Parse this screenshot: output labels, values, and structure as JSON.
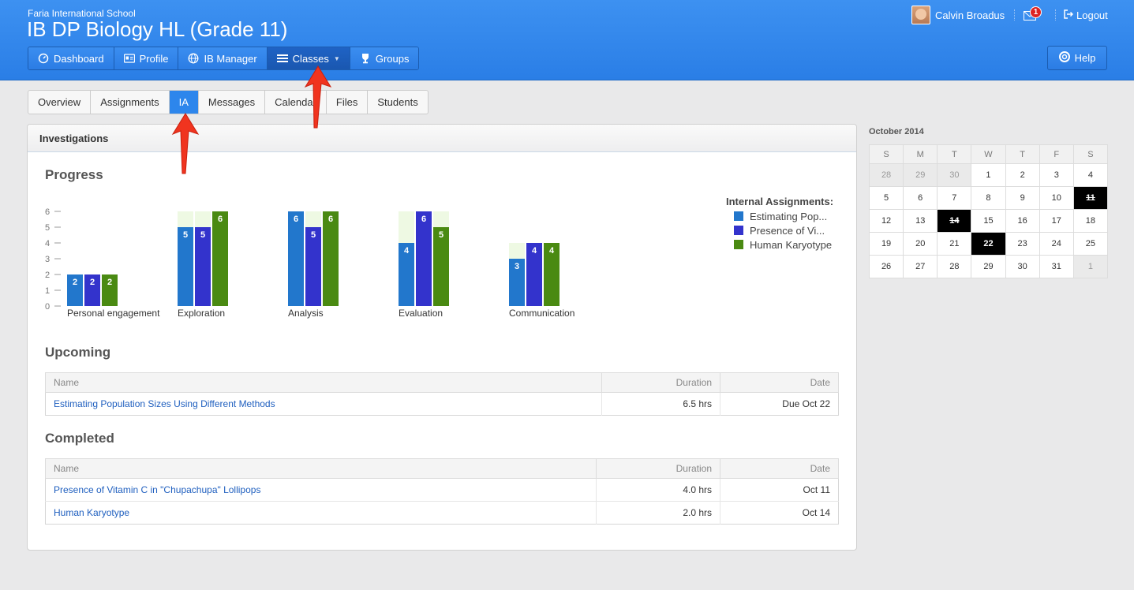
{
  "header": {
    "school": "Faria International School",
    "course": "IB DP Biology HL (Grade 11)",
    "nav": [
      {
        "label": "Dashboard",
        "icon": "dashboard-icon"
      },
      {
        "label": "Profile",
        "icon": "profile-card-icon"
      },
      {
        "label": "IB Manager",
        "icon": "globe-icon"
      },
      {
        "label": "Classes",
        "icon": "list-icon",
        "active": true
      },
      {
        "label": "Groups",
        "icon": "trophy-icon"
      }
    ],
    "user_name": "Calvin Broadus",
    "notification_count": "1",
    "logout_label": "Logout",
    "help_label": "Help"
  },
  "subtabs": [
    "Overview",
    "Assignments",
    "IA",
    "Messages",
    "Calendar",
    "Files",
    "Students"
  ],
  "panel": {
    "title": "Investigations",
    "progress_title": "Progress",
    "upcoming_title": "Upcoming",
    "completed_title": "Completed"
  },
  "chart_data": {
    "type": "bar",
    "categories": [
      "Personal engagement",
      "Exploration",
      "Analysis",
      "Evaluation",
      "Communication"
    ],
    "max_per_category": [
      2,
      6,
      6,
      6,
      4
    ],
    "series": [
      {
        "name": "Estimating Pop...",
        "values": [
          2,
          5,
          6,
          4,
          3
        ],
        "color": "#2277cc"
      },
      {
        "name": "Presence of Vi...",
        "values": [
          2,
          5,
          5,
          6,
          4
        ],
        "color": "#3333cc"
      },
      {
        "name": "Human Karyotype",
        "values": [
          2,
          6,
          6,
          5,
          4
        ],
        "color": "#4a8a12"
      }
    ],
    "y_ticks": [
      "0",
      "1",
      "2",
      "3",
      "4",
      "5",
      "6"
    ],
    "ylim": [
      0,
      6
    ],
    "legend_title": "Internal Assignments:",
    "legend_position": "right"
  },
  "upcoming": {
    "headers": [
      "Name",
      "Duration",
      "Date"
    ],
    "rows": [
      {
        "name": "Estimating Population Sizes Using Different Methods",
        "duration": "6.5 hrs",
        "date": "Due Oct 22"
      }
    ]
  },
  "completed": {
    "headers": [
      "Name",
      "Duration",
      "Date"
    ],
    "rows": [
      {
        "name": "Presence of Vitamin C in \"Chupachupa\" Lollipops",
        "duration": "4.0 hrs",
        "date": "Oct 11"
      },
      {
        "name": "Human Karyotype",
        "duration": "2.0 hrs",
        "date": "Oct 14"
      }
    ]
  },
  "calendar": {
    "title": "October 2014",
    "weekdays": [
      "S",
      "M",
      "T",
      "W",
      "T",
      "F",
      "S"
    ],
    "weeks": [
      [
        "28",
        "29",
        "30",
        "1",
        "2",
        "3",
        "4"
      ],
      [
        "5",
        "6",
        "7",
        "8",
        "9",
        "10",
        "11"
      ],
      [
        "12",
        "13",
        "14",
        "15",
        "16",
        "17",
        "18"
      ],
      [
        "19",
        "20",
        "21",
        "22",
        "23",
        "24",
        "25"
      ],
      [
        "26",
        "27",
        "28",
        "29",
        "30",
        "31",
        "1"
      ]
    ],
    "other_month": [
      "0-0",
      "0-1",
      "0-2",
      "4-6"
    ],
    "marked_done": [
      "1-6",
      "2-2"
    ],
    "marked_due": [
      "3-3"
    ]
  },
  "colors": {
    "header_blue": "#3289ee",
    "active_tab": "#2d86ec",
    "bar_background": "#eef9e3",
    "due_red": "#cc0000",
    "annotation_arrow": "#f0341f"
  }
}
